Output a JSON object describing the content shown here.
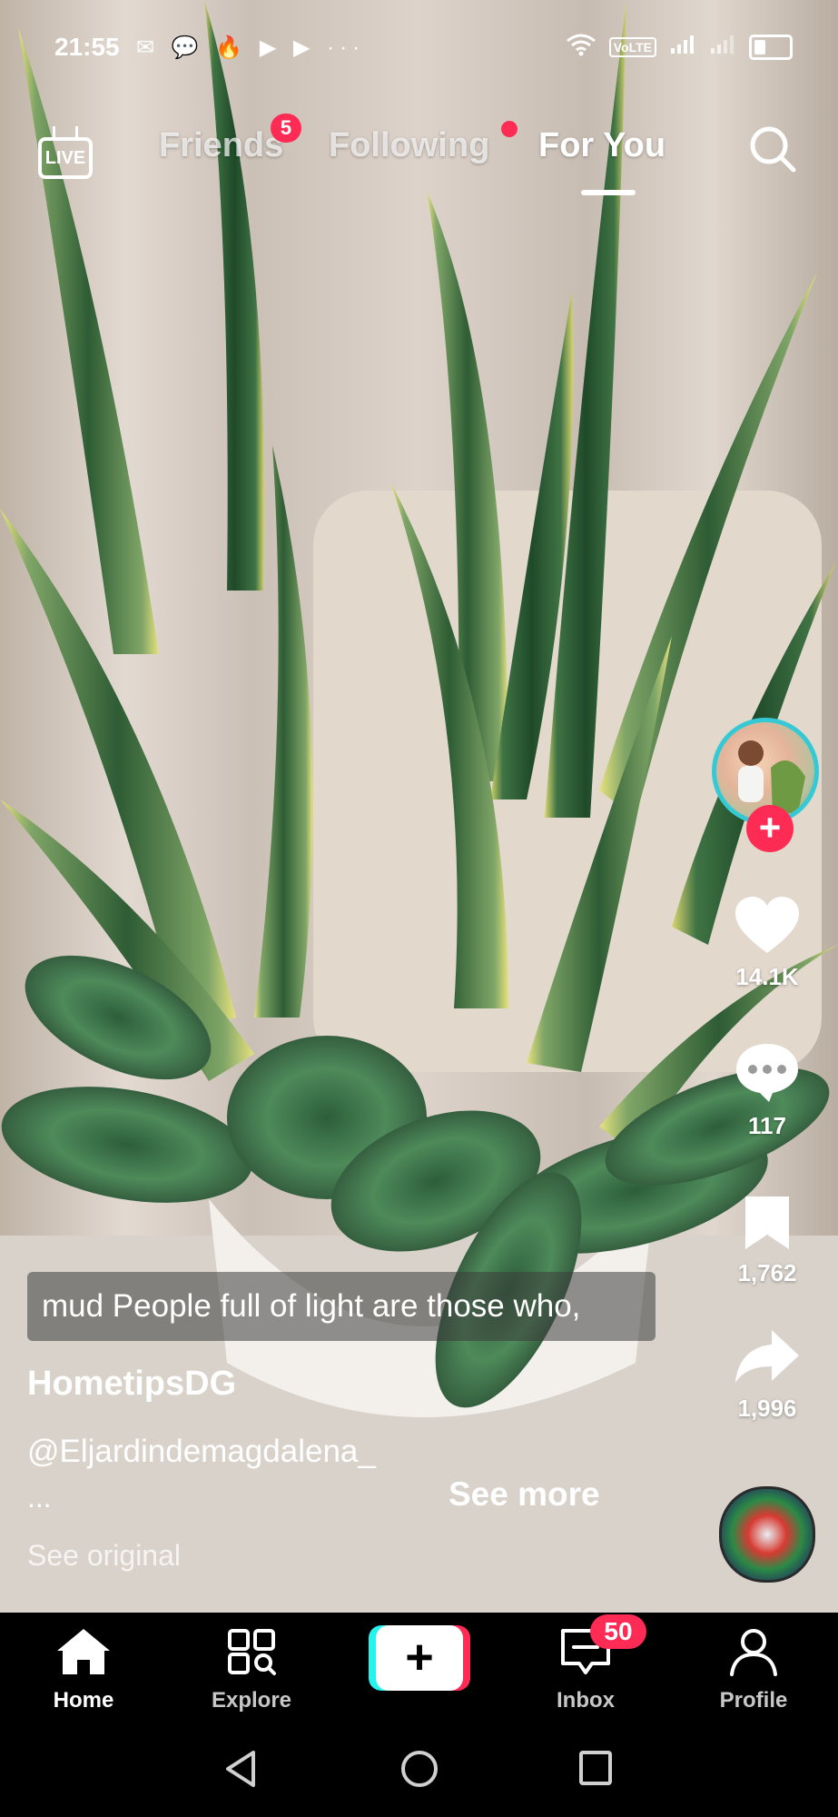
{
  "status_bar": {
    "time": "21:55",
    "left_icons": "✉ 💬 🔥 ▶ ▶ ···",
    "network": "VoLTE"
  },
  "top_nav": {
    "live_label": "LIVE",
    "tabs": [
      {
        "label": "Friends",
        "badge": "5"
      },
      {
        "label": "Following"
      },
      {
        "label": "For You",
        "active": true
      }
    ]
  },
  "video": {
    "subtitle": "mud People full of light are those who,",
    "author": "HometipsDG",
    "description": "@Eljardindemagdalena_",
    "ellipsis": "...",
    "see_more": "See more",
    "see_original": "See original"
  },
  "actions": {
    "likes": "14.1K",
    "comments": "117",
    "saves": "1,762",
    "shares": "1,996"
  },
  "tabbar": {
    "home": "Home",
    "explore": "Explore",
    "inbox": "Inbox",
    "inbox_badge": "50",
    "profile": "Profile"
  },
  "colors": {
    "accent": "#fe2c55",
    "cyan": "#25f4ee",
    "leaf_dark": "#2f5e34",
    "leaf_edge": "#e8e27a"
  }
}
